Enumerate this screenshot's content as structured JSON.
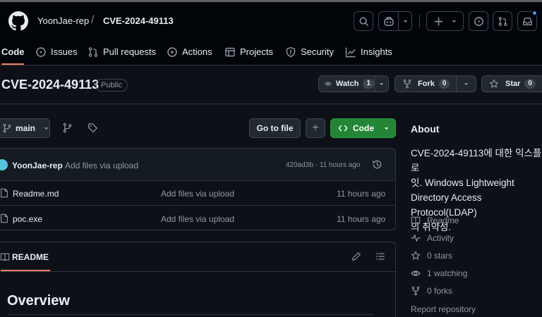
{
  "header": {
    "owner": "YoonJae-rep",
    "separator": "/",
    "repo": "CVE-2024-49113"
  },
  "nav": {
    "tabs": [
      {
        "label": "Code",
        "icon": "code-icon",
        "active": true
      },
      {
        "label": "Issues",
        "icon": "issue-opened-icon"
      },
      {
        "label": "Pull requests",
        "icon": "git-pull-request-icon"
      },
      {
        "label": "Actions",
        "icon": "play-icon"
      },
      {
        "label": "Projects",
        "icon": "table-icon"
      },
      {
        "label": "Security",
        "icon": "shield-icon"
      },
      {
        "label": "Insights",
        "icon": "graph-icon"
      }
    ]
  },
  "repo": {
    "title": "CVE-2024-49113",
    "visibility": "Public",
    "watch_label": "Watch",
    "watch_count": "1",
    "fork_label": "Fork",
    "fork_count": "0",
    "star_label": "Star",
    "star_count": "0"
  },
  "toolbar": {
    "branch": "main",
    "go_to_file": "Go to file",
    "add": "+",
    "code_label": "Code"
  },
  "commit": {
    "author": "YoonJae-rep",
    "message": "Add files via upload",
    "hash_time": "420ad3b · 11 hours ago"
  },
  "files": [
    {
      "name": "Readme.md",
      "message": "Add files via upload",
      "time": "11 hours ago"
    },
    {
      "name": "poc.exe",
      "message": "Add files via upload",
      "time": "11 hours ago"
    }
  ],
  "readme": {
    "tab_label": "README",
    "heading": "Overview"
  },
  "about": {
    "title": "About",
    "description": "CVE-2024-49113에 대한 익스플로\n잇. Windows Lightweight\nDirectory Access Protocol(LDAP)\n의 취약성.",
    "links": [
      {
        "icon": "book-icon",
        "label": "Readme"
      },
      {
        "icon": "pulse-icon",
        "label": "Activity"
      },
      {
        "icon": "star-icon",
        "label": "0 stars"
      },
      {
        "icon": "eye-icon",
        "label": "1 watching"
      },
      {
        "icon": "repo-forked-icon",
        "label": "0 forks"
      }
    ],
    "report": "Report repository"
  },
  "colors": {
    "background": "#0d1117",
    "header": "#010409",
    "accent_underline": "#f78166",
    "code_button": "#238636",
    "notification_dot": "#4493f8"
  }
}
